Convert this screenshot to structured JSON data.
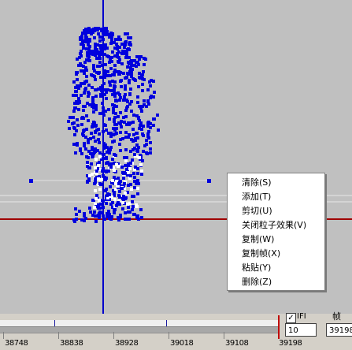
{
  "context_menu": {
    "items": [
      {
        "label": "清除(S)",
        "key": "S"
      },
      {
        "label": "添加(T)",
        "key": "T"
      },
      {
        "label": "剪切(U)",
        "key": "U"
      },
      {
        "label": "关闭粒子效果(V)",
        "key": "V"
      },
      {
        "label": "复制(W)",
        "key": "W"
      },
      {
        "label": "复制帧(X)",
        "key": "X"
      },
      {
        "label": "粘贴(Y)",
        "key": "Y"
      },
      {
        "label": "删除(Z)",
        "key": "Z"
      }
    ]
  },
  "timeline": {
    "labels": [
      "38748",
      "38838",
      "38928",
      "39018",
      "39108",
      "39198"
    ],
    "fps_label": "IFI",
    "fps_checked": true,
    "fps_value": "10",
    "frame_label": "帧",
    "frame_value": "39198"
  },
  "colors": {
    "background": "#c0c0c0",
    "particle": "#0000dd",
    "axis_vertical": "#0000cc",
    "axis_horizontal": "#a00000",
    "menu_bg": "#ffffff"
  }
}
